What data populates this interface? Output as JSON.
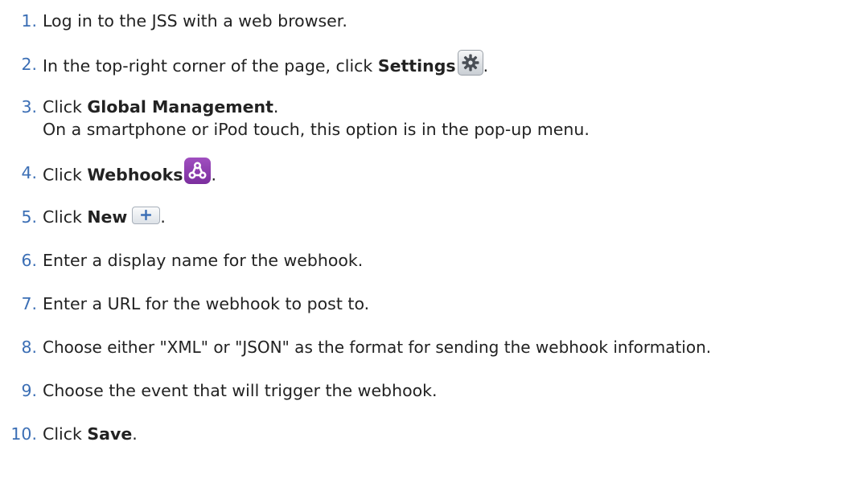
{
  "steps": [
    {
      "number": "1.",
      "text": "Log in to the JSS with a web browser."
    },
    {
      "number": "2.",
      "before": "In the top-right corner of the page, click ",
      "bold": "Settings",
      "after": ".",
      "icon": "gear-icon"
    },
    {
      "number": "3.",
      "before": "Click ",
      "bold": "Global Management",
      "after": ".",
      "sub": "On a smartphone or iPod touch, this option is in the pop-up menu."
    },
    {
      "number": "4.",
      "before": "Click ",
      "bold": "Webhooks",
      "after": ".",
      "icon": "webhooks-icon"
    },
    {
      "number": "5.",
      "before": "Click ",
      "bold": "New",
      "after": ".",
      "icon": "plus-icon"
    },
    {
      "number": "6.",
      "text": "Enter a display name for the webhook."
    },
    {
      "number": "7.",
      "text": "Enter a URL for the webhook to post to."
    },
    {
      "number": "8.",
      "text": "Choose either \"XML\" or \"JSON\" as the format for sending the webhook information."
    },
    {
      "number": "9.",
      "text": "Choose the event that will trigger the webhook."
    },
    {
      "number": "10.",
      "before": "Click ",
      "bold": "Save",
      "after": "."
    }
  ],
  "colors": {
    "number": "#3c6fb5",
    "text": "#222222",
    "webhooks_icon": "#8a3aad"
  }
}
